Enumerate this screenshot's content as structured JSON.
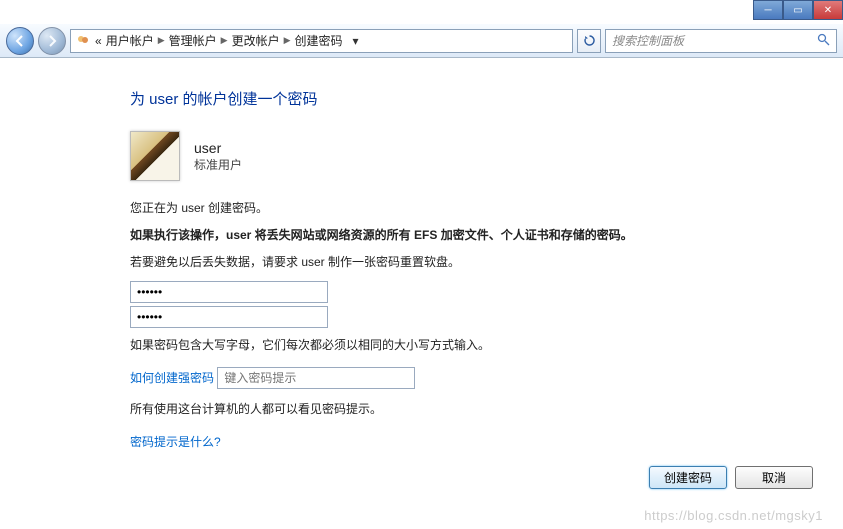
{
  "window": {
    "breadcrumbs": [
      "用户帐户",
      "管理帐户",
      "更改帐户",
      "创建密码"
    ],
    "search_placeholder": "搜索控制面板"
  },
  "page": {
    "heading": "为 user 的帐户创建一个密码",
    "user_name": "user",
    "user_type": "标准用户",
    "info1": "您正在为 user 创建密码。",
    "warn": "如果执行该操作，user 将丢失网站或网络资源的所有 EFS 加密文件、个人证书和存储的密码。",
    "info2": "若要避免以后丢失数据，请要求 user 制作一张密码重置软盘。",
    "pw1_value": "••••••",
    "pw2_value": "••••••",
    "case_note": "如果密码包含大写字母，它们每次都必须以相同的大小写方式输入。",
    "link_strong": "如何创建强密码",
    "hint_placeholder": "键入密码提示",
    "hint_note": "所有使用这台计算机的人都可以看见密码提示。",
    "link_hint": "密码提示是什么?"
  },
  "buttons": {
    "create": "创建密码",
    "cancel": "取消"
  },
  "watermark": "https://blog.csdn.net/mgsky1"
}
